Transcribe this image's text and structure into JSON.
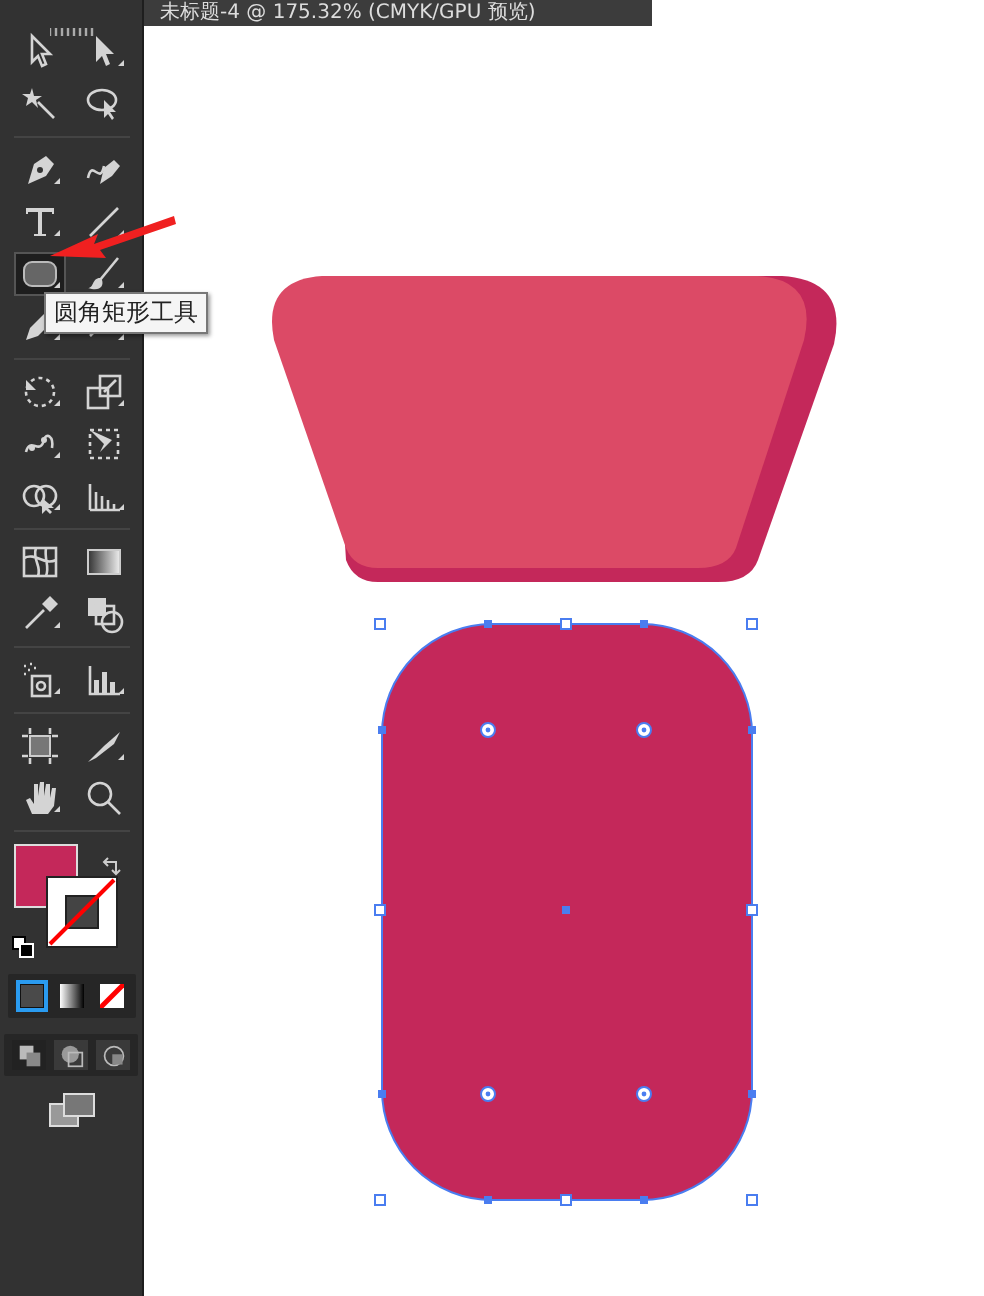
{
  "document_tab": {
    "title": "未标题-4 @ 175.32% (CMYK/GPU 预览)"
  },
  "toolbar": {
    "tools": [
      {
        "selected": false
      },
      {
        "selected": false
      },
      {
        "selected": false
      },
      {
        "selected": false
      },
      {
        "selected": false
      },
      {
        "selected": false
      },
      {
        "selected": false
      },
      {
        "selected": false
      },
      {
        "selected": true
      },
      {
        "selected": false
      },
      {
        "selected": false
      },
      {
        "selected": false
      },
      {
        "selected": false
      },
      {
        "selected": false
      },
      {
        "selected": false
      },
      {
        "selected": false
      },
      {
        "selected": false
      },
      {
        "selected": false
      },
      {
        "selected": false
      },
      {
        "selected": false
      },
      {
        "selected": false
      },
      {
        "selected": false
      },
      {
        "selected": false
      },
      {
        "selected": false
      },
      {
        "selected": false
      },
      {
        "selected": false
      },
      {
        "selected": false
      },
      {
        "selected": false
      }
    ],
    "fill": {
      "color": "#c4285a"
    },
    "color_modes": [
      {
        "selected": true
      },
      {
        "selected": false
      },
      {
        "selected": false
      }
    ],
    "draw_modes": [
      {
        "selected": true
      },
      {
        "selected": false
      },
      {
        "selected": false
      }
    ]
  },
  "tooltip": {
    "text": "圆角矩形工具"
  },
  "canvas": {
    "shapes": [
      {
        "kind": "trapezoid",
        "color": "#dc4a66"
      },
      {
        "kind": "rounded-rectangle",
        "color": "#c4285a",
        "selected": true
      }
    ]
  }
}
